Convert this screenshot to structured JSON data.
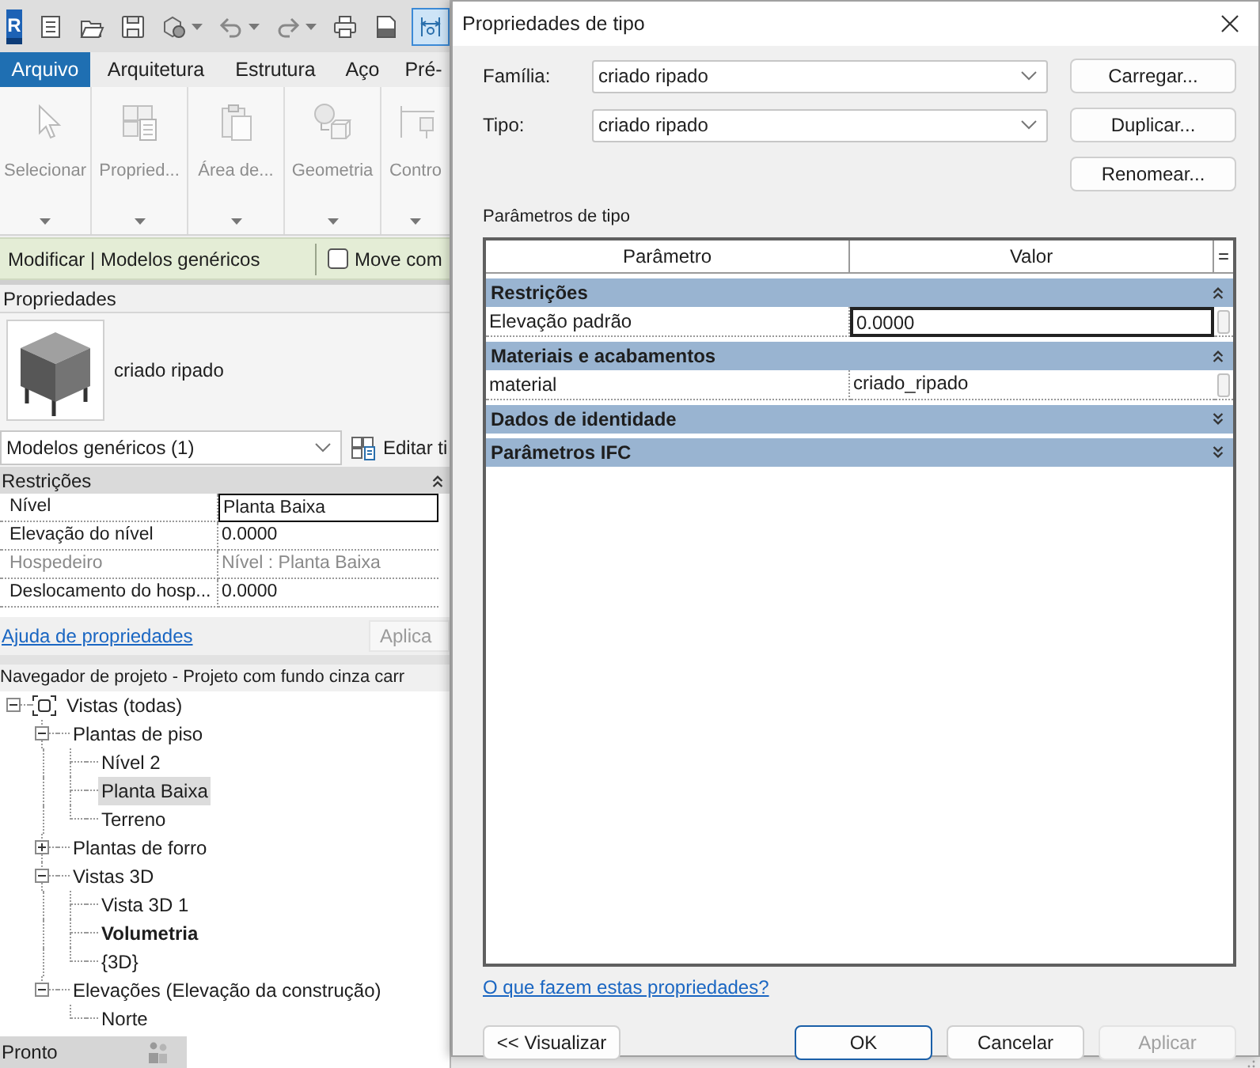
{
  "app": {
    "logo": "R",
    "quick_access": [
      {
        "kind": "list",
        "menu": false,
        "on": false
      },
      {
        "kind": "open",
        "menu": false,
        "on": false
      },
      {
        "kind": "save",
        "menu": false,
        "on": false
      },
      {
        "kind": "sync",
        "menu": true,
        "on": false
      },
      {
        "kind": "undo",
        "menu": true,
        "on": false
      },
      {
        "kind": "redo",
        "menu": true,
        "on": false
      },
      {
        "kind": "print",
        "menu": false,
        "on": false
      },
      {
        "kind": "pdf",
        "menu": false,
        "on": false
      },
      {
        "kind": "measure",
        "menu": false,
        "on": true
      }
    ],
    "ribbon_tabs": [
      {
        "label": "Arquivo",
        "selected": true
      },
      {
        "label": "Arquitetura",
        "selected": false
      },
      {
        "label": "Estrutura",
        "selected": false
      },
      {
        "label": "Aço",
        "selected": false
      },
      {
        "label": "Pré-",
        "selected": false
      }
    ],
    "ribbon_buttons": [
      {
        "kind": "select",
        "label": "Selecionar",
        "disabled": true
      },
      {
        "kind": "properties",
        "label": "Propried...",
        "disabled": true
      },
      {
        "kind": "clipboard",
        "label": "Área de...",
        "disabled": true
      },
      {
        "kind": "geometry",
        "label": "Geometria",
        "disabled": true
      },
      {
        "kind": "dimension",
        "label": "Contro",
        "disabled": true
      }
    ],
    "context_bar": {
      "title": "Modificar | Modelos genéricos",
      "checkbox": {
        "label": "Move com",
        "checked": false
      }
    },
    "properties": {
      "title": "Propriedades",
      "type_name": "criado ripado",
      "selector": "Modelos genéricos (1)",
      "edit_type": "Editar ti",
      "group": {
        "label": "Restrições",
        "expanded": true,
        "rows": [
          {
            "name": "Nível",
            "value": "Planta Baixa",
            "selected": true,
            "disabled": false
          },
          {
            "name": "Elevação do nível",
            "value": "0.0000",
            "selected": false,
            "disabled": false
          },
          {
            "name": "Hospedeiro",
            "value": "Nível : Planta Baixa",
            "selected": false,
            "disabled": true
          },
          {
            "name": "Deslocamento do hosp...",
            "value": "0.0000",
            "selected": false,
            "disabled": false
          }
        ]
      },
      "help_link": "Ajuda de propriedades",
      "apply_button": {
        "label": "Aplica",
        "disabled": true
      }
    },
    "project_browser": {
      "title": "Navegador de projeto - Projeto com fundo cinza carr",
      "tree": [
        {
          "label": "Vistas (todas)",
          "expanded": true,
          "selected": false,
          "current": false,
          "children": [
            {
              "label": "Plantas de piso",
              "expanded": true,
              "selected": false,
              "current": false,
              "children": [
                {
                  "label": "Nível 2",
                  "selected": false,
                  "current": false
                },
                {
                  "label": "Planta Baixa",
                  "selected": true,
                  "current": false
                },
                {
                  "label": "Terreno",
                  "selected": false,
                  "current": false
                }
              ]
            },
            {
              "label": "Plantas de forro",
              "expanded": false,
              "selected": false,
              "current": false
            },
            {
              "label": "Vistas 3D",
              "expanded": true,
              "selected": false,
              "current": false,
              "children": [
                {
                  "label": "Vista 3D 1",
                  "selected": false,
                  "current": false
                },
                {
                  "label": "Volumetria",
                  "selected": false,
                  "current": true
                },
                {
                  "label": "{3D}",
                  "selected": false,
                  "current": false
                }
              ]
            },
            {
              "label": "Elevações (Elevação da construção)",
              "expanded": true,
              "selected": false,
              "current": false,
              "children": [
                {
                  "label": "Norte",
                  "selected": false,
                  "current": false
                }
              ]
            }
          ]
        }
      ]
    },
    "status_bar": {
      "text": "Pronto"
    }
  },
  "dialog": {
    "title": "Propriedades de tipo",
    "fields": [
      {
        "label": "Família:",
        "value": "criado ripado",
        "button": "Carregar..."
      },
      {
        "label": "Tipo:",
        "value": "criado ripado",
        "button": "Duplicar..."
      }
    ],
    "extra_button": "Renomear...",
    "section_label": "Parâmetros de tipo",
    "table": {
      "columns": [
        "Parâmetro",
        "Valor",
        "="
      ],
      "groups": [
        {
          "label": "Restrições",
          "expanded": true,
          "rows": [
            {
              "name": "Elevação padrão",
              "value": "0.0000",
              "selected": true
            }
          ]
        },
        {
          "label": "Materiais e acabamentos",
          "expanded": true,
          "rows": [
            {
              "name": "material",
              "value": "criado_ripado",
              "selected": false
            }
          ]
        },
        {
          "label": "Dados de identidade",
          "expanded": false
        },
        {
          "label": "Parâmetros IFC",
          "expanded": false
        }
      ]
    },
    "help_link": "O que fazem estas propriedades?",
    "buttons": [
      {
        "label": "<< Visualizar",
        "kind": "normal",
        "disabled": false
      },
      {
        "label": "OK",
        "kind": "default",
        "disabled": false
      },
      {
        "label": "Cancelar",
        "kind": "normal",
        "disabled": false
      },
      {
        "label": "Aplicar",
        "kind": "normal",
        "disabled": true
      }
    ]
  }
}
